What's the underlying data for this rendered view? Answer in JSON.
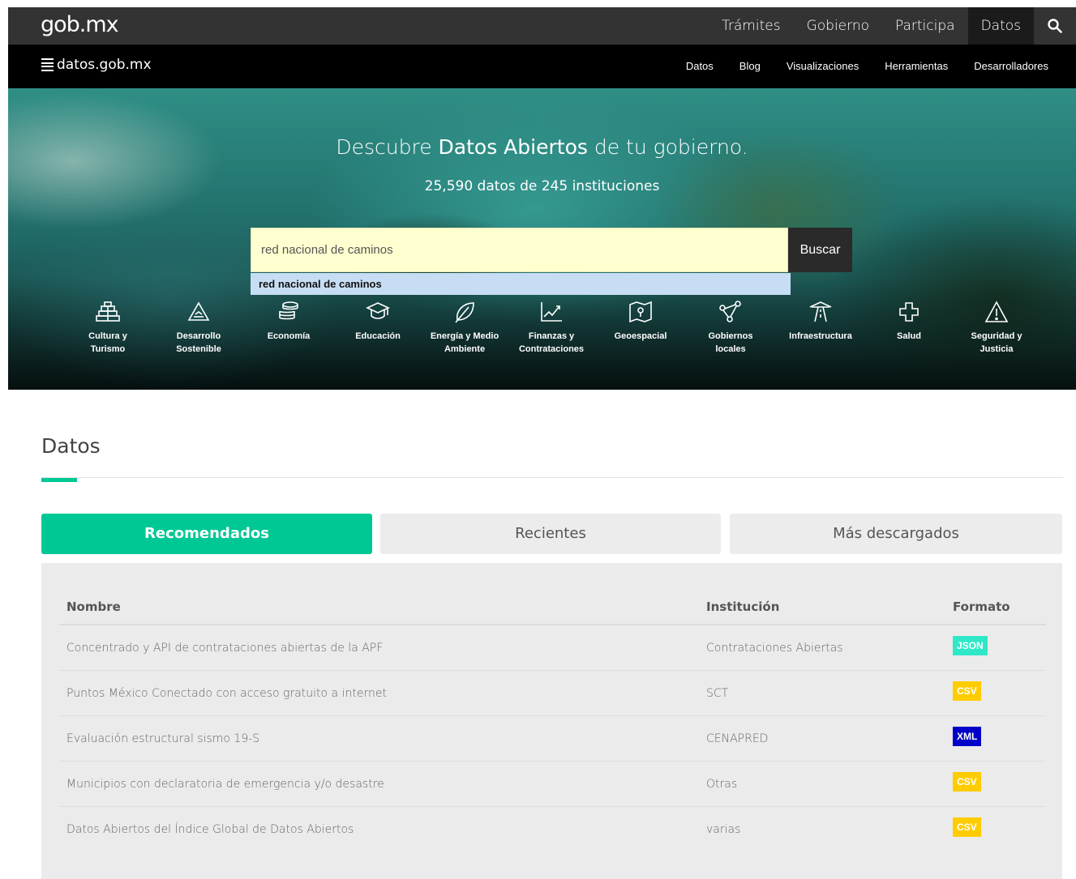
{
  "topbar": {
    "logo": "gob.mx",
    "nav": [
      "Trámites",
      "Gobierno",
      "Participa",
      "Datos"
    ],
    "active": "Datos",
    "search_icon": "search-icon"
  },
  "subbar": {
    "brand": "datos.gob.mx",
    "nav": [
      "Datos",
      "Blog",
      "Visualizaciones",
      "Herramientas",
      "Desarrolladores"
    ]
  },
  "hero": {
    "headline_pre": "Descubre ",
    "headline_bold": "Datos Abiertos",
    "headline_post": " de tu gobierno.",
    "count": "25,590 datos de 245 instituciones",
    "search_value": "red nacional de caminos",
    "search_button": "Buscar",
    "suggestion": "red nacional de caminos",
    "categories": [
      {
        "l1": "Cultura y",
        "l2": "Turismo",
        "icon": "pyramid-icon"
      },
      {
        "l1": "Desarrollo",
        "l2": "Sostenible",
        "icon": "recycle-icon"
      },
      {
        "l1": "Economía",
        "l2": "",
        "icon": "coins-icon"
      },
      {
        "l1": "Educación",
        "l2": "",
        "icon": "graduation-cap-icon"
      },
      {
        "l1": "Energía y Medio",
        "l2": "Ambiente",
        "icon": "leaf-icon"
      },
      {
        "l1": "Finanzas y",
        "l2": "Contrataciones",
        "icon": "line-chart-icon"
      },
      {
        "l1": "Geoespacial",
        "l2": "",
        "icon": "map-icon"
      },
      {
        "l1": "Gobiernos",
        "l2": "locales",
        "icon": "network-icon"
      },
      {
        "l1": "Infraestructura",
        "l2": "",
        "icon": "road-icon"
      },
      {
        "l1": "Salud",
        "l2": "",
        "icon": "medical-cross-icon"
      },
      {
        "l1": "Seguridad y",
        "l2": "Justicia",
        "icon": "warning-icon"
      }
    ]
  },
  "datos": {
    "title": "Datos",
    "tabs": [
      "Recomendados",
      "Recientes",
      "Más descargados"
    ],
    "active_tab": "Recomendados",
    "columns": [
      "Nombre",
      "Institución",
      "Formato"
    ],
    "rows": [
      {
        "name": "Concentrado y API de contrataciones abiertas de la APF",
        "inst": "Contrataciones Abiertas",
        "format": "JSON",
        "color": "#2ee8c8"
      },
      {
        "name": "Puntos México Conectado con acceso gratuito a internet",
        "inst": "SCT",
        "format": "CSV",
        "color": "#ffcc00"
      },
      {
        "name": "Evaluación estructural sismo 19-S",
        "inst": "CENAPRED",
        "format": "XML",
        "color": "#0000c8"
      },
      {
        "name": "Municipios con declaratoria de emergencia y/o desastre",
        "inst": "Otras",
        "format": "CSV",
        "color": "#ffcc00"
      },
      {
        "name": "Datos Abiertos del Índice Global de Datos Abiertos",
        "inst": "varias",
        "format": "CSV",
        "color": "#ffcc00"
      }
    ]
  },
  "colors": {
    "accent": "#00c894",
    "topbar": "#333333",
    "subbar": "#000000",
    "search_bg": "#ffffd0",
    "suggest_bg": "#c7ddf4"
  }
}
